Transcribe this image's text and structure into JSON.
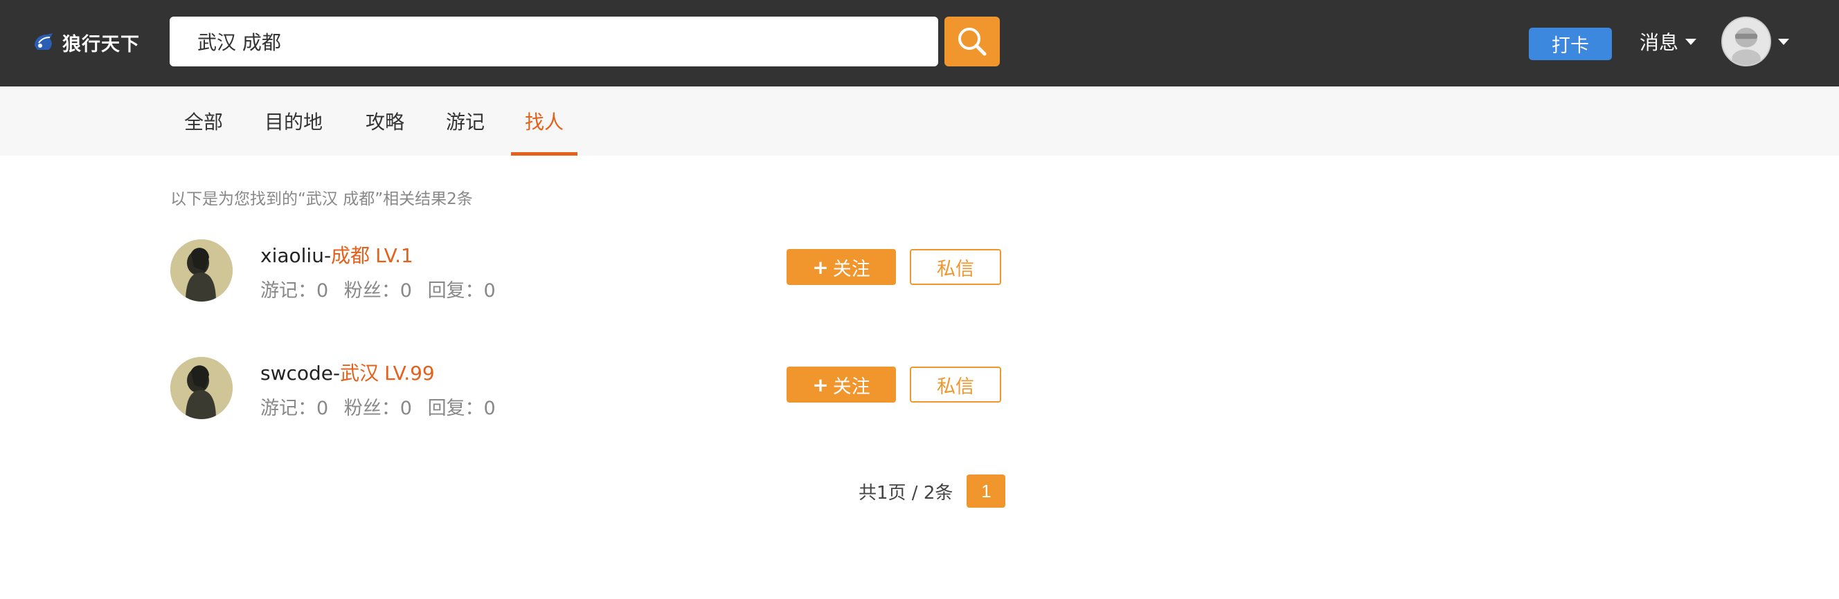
{
  "header": {
    "logo_text": "狼行天下",
    "search_value": "武汉 成都",
    "checkin_label": "打卡",
    "messages_label": "消息"
  },
  "tabs": [
    {
      "label": "全部"
    },
    {
      "label": "目的地"
    },
    {
      "label": "攻略"
    },
    {
      "label": "游记"
    },
    {
      "label": "找人"
    }
  ],
  "active_tab": "找人",
  "results": {
    "summary": "以下是为您找到的“武汉 成都”相关结果2条",
    "users": [
      {
        "name_prefix": "xiaoliu-",
        "city": "成都",
        "level": "LV.1",
        "stats": {
          "travel_notes": "游记：0",
          "fans": "粉丝：0",
          "replies": "回复：0"
        },
        "follow_label": "关注",
        "message_label": "私信"
      },
      {
        "name_prefix": "swcode-",
        "city": "武汉",
        "level": "LV.99",
        "stats": {
          "travel_notes": "游记：0",
          "fans": "粉丝：0",
          "replies": "回复：0"
        },
        "follow_label": "关注",
        "message_label": "私信"
      }
    ]
  },
  "pagination": {
    "info": "共1页 / 2条",
    "current_page": "1"
  },
  "colors": {
    "header_bg": "#333333",
    "accent_orange": "#f0962d",
    "active_tab": "#e5601a",
    "checkin_blue": "#3b88de"
  }
}
